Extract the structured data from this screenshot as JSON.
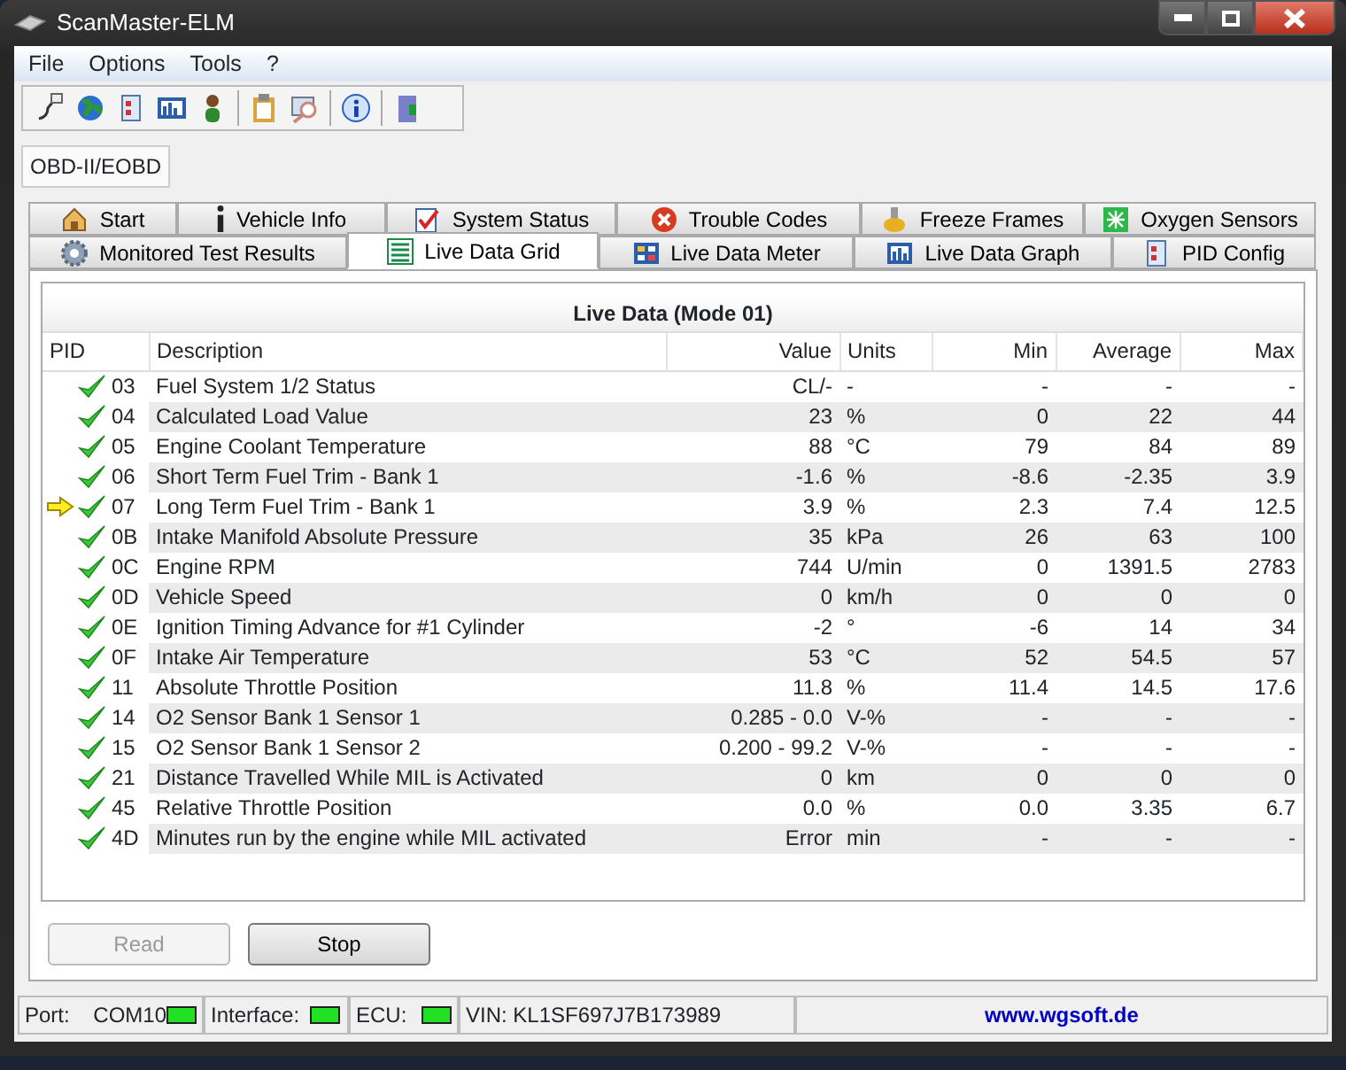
{
  "window": {
    "title": "ScanMaster-ELM"
  },
  "menu": [
    "File",
    "Options",
    "Tools",
    "?"
  ],
  "mode_tab": {
    "label": "OBD-II/EOBD",
    "selected": true
  },
  "tabs_row_1": [
    {
      "label": "Start",
      "selected": false
    },
    {
      "label": "Vehicle Info",
      "selected": false
    },
    {
      "label": "System Status",
      "selected": false
    },
    {
      "label": "Trouble Codes",
      "selected": false
    },
    {
      "label": "Freeze Frames",
      "selected": false
    },
    {
      "label": "Oxygen Sensors",
      "selected": false
    }
  ],
  "tabs_row_2": [
    {
      "label": "Monitored Test Results",
      "selected": false
    },
    {
      "label": "Live Data Grid",
      "selected": true
    },
    {
      "label": "Live Data Meter",
      "selected": false
    },
    {
      "label": "Live Data Graph",
      "selected": false
    },
    {
      "label": "PID Config",
      "selected": false
    }
  ],
  "grid": {
    "title": "Live Data (Mode 01)",
    "columns": [
      "PID",
      "Description",
      "Value",
      "Units",
      "Min",
      "Average",
      "Max"
    ],
    "rows": [
      {
        "pid": "03",
        "description": "Fuel System 1/2 Status",
        "value": "CL/-",
        "units": "-",
        "min": "-",
        "average": "-",
        "max": "-",
        "selected": false
      },
      {
        "pid": "04",
        "description": "Calculated Load Value",
        "value": "23",
        "units": "%",
        "min": "0",
        "average": "22",
        "max": "44",
        "selected": false
      },
      {
        "pid": "05",
        "description": "Engine Coolant Temperature",
        "value": "88",
        "units": "°C",
        "min": "79",
        "average": "84",
        "max": "89",
        "selected": false
      },
      {
        "pid": "06",
        "description": "Short Term Fuel Trim - Bank 1",
        "value": "-1.6",
        "units": "%",
        "min": "-8.6",
        "average": "-2.35",
        "max": "3.9",
        "selected": false
      },
      {
        "pid": "07",
        "description": "Long Term Fuel Trim - Bank 1",
        "value": "3.9",
        "units": "%",
        "min": "2.3",
        "average": "7.4",
        "max": "12.5",
        "selected": true
      },
      {
        "pid": "0B",
        "description": "Intake Manifold Absolute Pressure",
        "value": "35",
        "units": "kPa",
        "min": "26",
        "average": "63",
        "max": "100",
        "selected": false
      },
      {
        "pid": "0C",
        "description": "Engine RPM",
        "value": "744",
        "units": "U/min",
        "min": "0",
        "average": "1391.5",
        "max": "2783",
        "selected": false
      },
      {
        "pid": "0D",
        "description": "Vehicle Speed",
        "value": "0",
        "units": "km/h",
        "min": "0",
        "average": "0",
        "max": "0",
        "selected": false
      },
      {
        "pid": "0E",
        "description": "Ignition Timing Advance for #1 Cylinder",
        "value": "-2",
        "units": "°",
        "min": "-6",
        "average": "14",
        "max": "34",
        "selected": false
      },
      {
        "pid": "0F",
        "description": "Intake Air Temperature",
        "value": "53",
        "units": "°C",
        "min": "52",
        "average": "54.5",
        "max": "57",
        "selected": false
      },
      {
        "pid": "11",
        "description": "Absolute Throttle Position",
        "value": "11.8",
        "units": "%",
        "min": "11.4",
        "average": "14.5",
        "max": "17.6",
        "selected": false
      },
      {
        "pid": "14",
        "description": "O2 Sensor Bank 1 Sensor 1",
        "value": "0.285 - 0.0",
        "units": "V-%",
        "min": "-",
        "average": "-",
        "max": "-",
        "selected": false
      },
      {
        "pid": "15",
        "description": "O2 Sensor Bank 1 Sensor 2",
        "value": "0.200 - 99.2",
        "units": "V-%",
        "min": "-",
        "average": "-",
        "max": "-",
        "selected": false
      },
      {
        "pid": "21",
        "description": "Distance Travelled While MIL is Activated",
        "value": "0",
        "units": "km",
        "min": "0",
        "average": "0",
        "max": "0",
        "selected": false
      },
      {
        "pid": "45",
        "description": "Relative Throttle Position",
        "value": "0.0",
        "units": "%",
        "min": "0.0",
        "average": "3.35",
        "max": "6.7",
        "selected": false
      },
      {
        "pid": "4D",
        "description": "Minutes run by the engine while MIL activated",
        "value": "Error",
        "units": "min",
        "min": "-",
        "average": "-",
        "max": "-",
        "selected": false
      }
    ]
  },
  "buttons": [
    {
      "label": "Read",
      "disabled": true
    },
    {
      "label": "Stop",
      "disabled": false
    }
  ],
  "status_bar": {
    "port_label": "Port:",
    "port": "COM10",
    "port_on": true,
    "interface_label": "Interface:",
    "interface_on": true,
    "ecu_label": "ECU:",
    "ecu_on": true,
    "vin": "VIN: KL1SF697J7B173989",
    "link": "www.wgsoft.de"
  }
}
